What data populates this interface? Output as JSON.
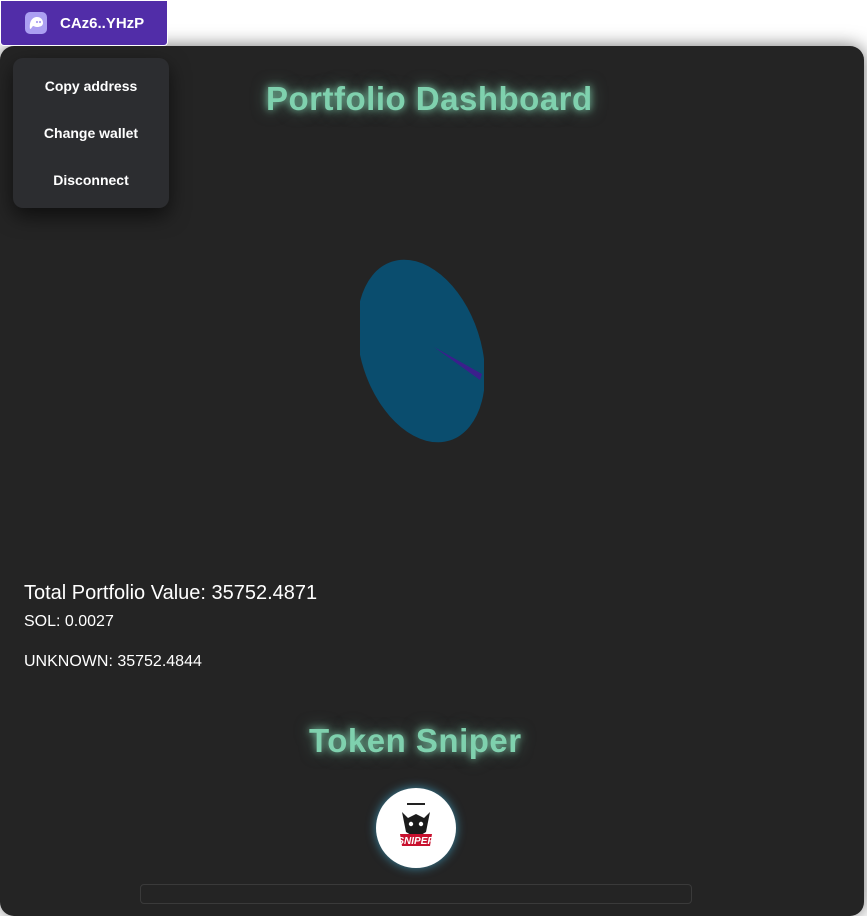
{
  "wallet": {
    "address": "CAz6..YHzP",
    "icon": "phantom-ghost-icon",
    "menu": [
      "Copy address",
      "Change wallet",
      "Disconnect"
    ]
  },
  "portfolio": {
    "title": "Portfolio Dashboard",
    "total_label": "Total Portfolio Value: 35752.4871",
    "holdings": [
      {
        "label": "SOL: 0.0027"
      },
      {
        "label": "UNKNOWN: 35752.4844"
      }
    ]
  },
  "chart_data": {
    "type": "pie",
    "categories": [
      "SOL",
      "UNKNOWN"
    ],
    "values": [
      0.0027,
      35752.4844
    ],
    "colors": [
      "#3b1f8c",
      "#0a4d6e"
    ]
  },
  "sniper": {
    "title": "Token Sniper",
    "logo_text": "SNIPER"
  },
  "colors": {
    "accent": "#512da8",
    "glow": "#7fd1ae",
    "panel": "#242424"
  }
}
